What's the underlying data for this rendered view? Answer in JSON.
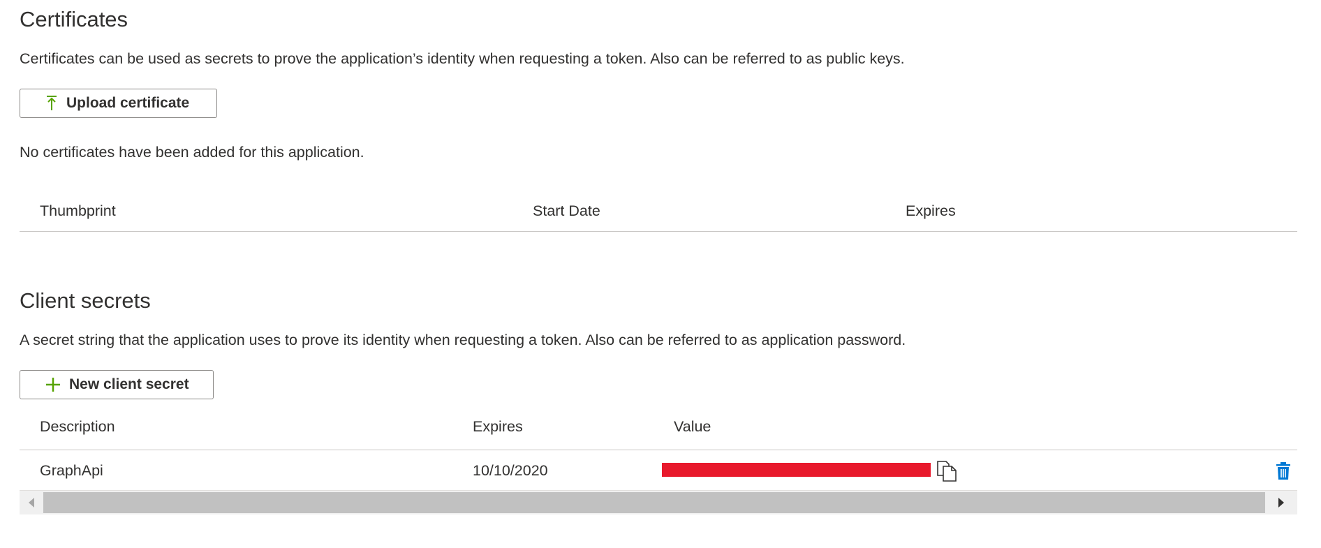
{
  "certificates": {
    "title": "Certificates",
    "description": "Certificates can be used as secrets to prove the application’s identity when requesting a token. Also can be referred to as public keys.",
    "upload_button": {
      "label": "Upload certificate",
      "icon": "upload-arrow-icon"
    },
    "empty_message": "No certificates have been added for this application.",
    "columns": [
      "Thumbprint",
      "Start Date",
      "Expires"
    ]
  },
  "client_secrets": {
    "title": "Client secrets",
    "description": "A secret string that the application uses to prove its identity when requesting a token. Also can be referred to as application password.",
    "new_button": {
      "label": "New client secret",
      "icon": "plus-icon"
    },
    "columns": [
      "Description",
      "Expires",
      "Value"
    ],
    "rows": [
      {
        "description": "GraphApi",
        "expires": "10/10/2020",
        "value": "",
        "value_redacted": true,
        "copy_icon": "copy-icon",
        "delete_icon": "trash-icon"
      }
    ]
  },
  "colors": {
    "accent_green": "#57a300",
    "delete_blue": "#0078d4",
    "redaction_red": "#e8192c"
  }
}
